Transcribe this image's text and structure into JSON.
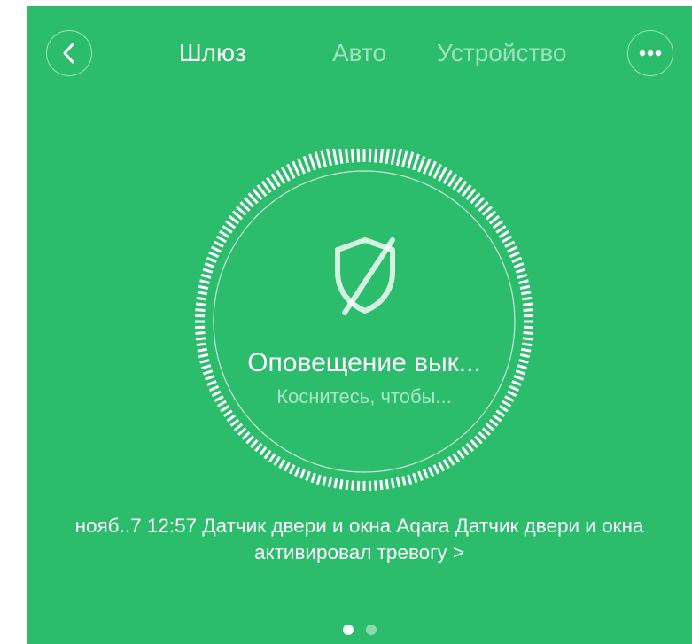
{
  "header": {
    "tabs": [
      {
        "label": "Шлюз",
        "active": true
      },
      {
        "label": "Авто",
        "active": false
      },
      {
        "label": "Устройство",
        "active": false
      }
    ],
    "back_icon": "chevron-left-icon",
    "more_icon": "more-dots-icon"
  },
  "alarm": {
    "icon": "shield-off-icon",
    "title": "Оповещение вык...",
    "subtitle": "Коснитесь, чтобы..."
  },
  "log": {
    "text": "нояб..7 12:57 Датчик двери и окна Aqara Датчик двери и окна активировал тревогу  >"
  },
  "pager": {
    "pages": 2,
    "current": 1
  },
  "colors": {
    "background": "#2cbd6c",
    "foreground": "#ffffff"
  }
}
